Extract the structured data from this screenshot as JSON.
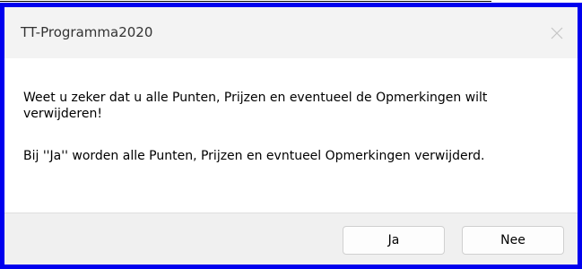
{
  "window": {
    "title": "TT-Programma2020",
    "close_icon": "close-icon"
  },
  "message": {
    "line1": "Weet u zeker dat u alle Punten, Prijzen en eventueel de Opmerkingen wilt verwijderen!",
    "line2": "Bij ''Ja'' worden alle Punten, Prijzen en evntueel Opmerkingen verwijderd."
  },
  "buttons": {
    "yes_label": "Ja",
    "no_label": "Nee"
  },
  "colors": {
    "frame_border": "#0000ee",
    "titlebar_bg": "#f3f3f3",
    "footer_bg": "#f0f0f0"
  }
}
